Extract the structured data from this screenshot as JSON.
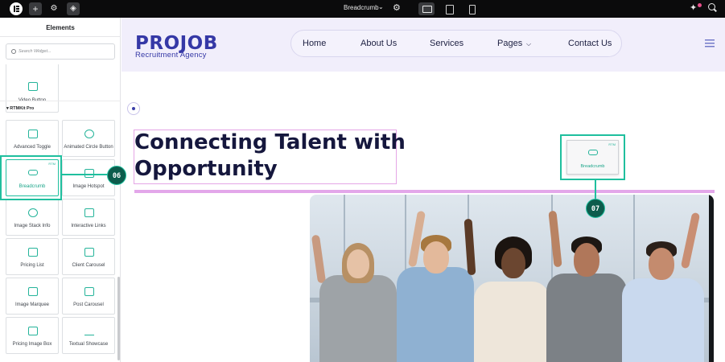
{
  "topbar": {
    "widget_title": "Breadcrumb",
    "icons": [
      "elementor-logo-icon",
      "plus-icon",
      "sliders-icon",
      "layers-icon",
      "chevron-down-icon",
      "gear-icon",
      "desktop-icon",
      "tablet-icon",
      "mobile-icon",
      "magic-icon",
      "search-icon"
    ]
  },
  "sidebar": {
    "title": "Elements",
    "search_placeholder": "Search Widget...",
    "section_label": "▾ RTMKit Pro",
    "badge": "RTM",
    "widgets": [
      {
        "label": "Video Button"
      },
      {
        "label": "Advanced Toggle"
      },
      {
        "label": "Animated Circle Button"
      },
      {
        "label": "Breadcrumb",
        "active": true
      },
      {
        "label": "Image Hotspot"
      },
      {
        "label": "Image Stack Info"
      },
      {
        "label": "Interactive Links"
      },
      {
        "label": "Pricing List"
      },
      {
        "label": "Client Carousel"
      },
      {
        "label": "Image Marquee"
      },
      {
        "label": "Post Carousel"
      },
      {
        "label": "Pricing Image Box"
      },
      {
        "label": "Textual Showcase"
      }
    ],
    "accent_color": "#1fbf9e"
  },
  "site": {
    "brand": "PROJOB",
    "brand_sub": "Recruitment Agency",
    "brand_color": "#3538a6",
    "nav": [
      {
        "label": "Home"
      },
      {
        "label": "About Us"
      },
      {
        "label": "Services"
      },
      {
        "label": "Pages"
      },
      {
        "label": "Contact Us"
      }
    ],
    "heading_line1": "Connecting Talent with",
    "heading_line2": "Opportunity",
    "dropped_widget": {
      "label": "Breadcrumb",
      "badge": "RTM"
    }
  },
  "callouts": {
    "first": "06",
    "second": "07"
  }
}
